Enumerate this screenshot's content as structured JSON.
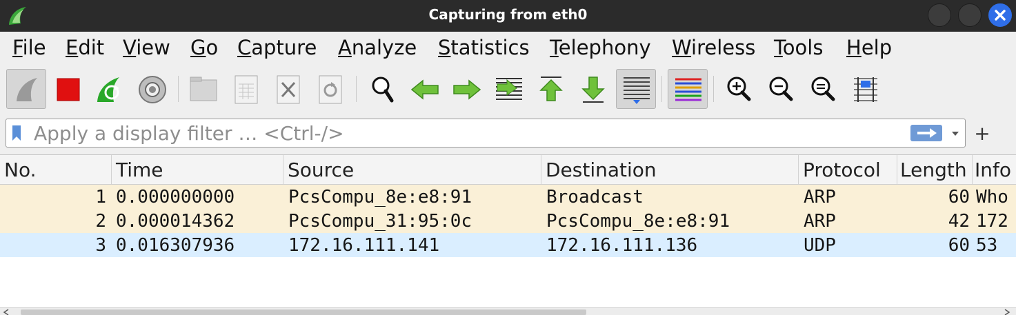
{
  "window": {
    "title": "Capturing from eth0",
    "accent": "#2f6ee8"
  },
  "menu": [
    "File",
    "Edit",
    "View",
    "Go",
    "Capture",
    "Analyze",
    "Statistics",
    "Telephony",
    "Wireless",
    "Tools",
    "Help"
  ],
  "toolbar": {
    "icons": [
      "start-capture-icon",
      "stop-capture-icon",
      "restart-capture-icon",
      "capture-options-icon",
      "open-file-icon",
      "save-file-icon",
      "close-file-icon",
      "reload-file-icon",
      "find-packet-icon",
      "go-back-icon",
      "go-forward-icon",
      "go-to-packet-icon",
      "go-first-packet-icon",
      "go-last-packet-icon",
      "autoscroll-icon",
      "colorize-icon",
      "zoom-in-icon",
      "zoom-out-icon",
      "normal-size-icon",
      "resize-columns-icon"
    ]
  },
  "filter": {
    "placeholder": "Apply a display filter … <Ctrl-/>",
    "add_label": "+"
  },
  "packet_list": {
    "columns": [
      "No.",
      "Time",
      "Source",
      "Destination",
      "Protocol",
      "Length",
      "Info"
    ],
    "rows": [
      {
        "no": "1",
        "time": "0.000000000",
        "source": "PcsCompu_8e:e8:91",
        "destination": "Broadcast",
        "protocol": "ARP",
        "length": "60",
        "info": "Who",
        "color": "#faf0d7"
      },
      {
        "no": "2",
        "time": "0.000014362",
        "source": "PcsCompu_31:95:0c",
        "destination": "PcsCompu_8e:e8:91",
        "protocol": "ARP",
        "length": "42",
        "info": "172",
        "color": "#faf0d7"
      },
      {
        "no": "3",
        "time": "0.016307936",
        "source": "172.16.111.141",
        "destination": "172.16.111.136",
        "protocol": "UDP",
        "length": "60",
        "info": "53",
        "color": "#daeeff"
      }
    ]
  }
}
